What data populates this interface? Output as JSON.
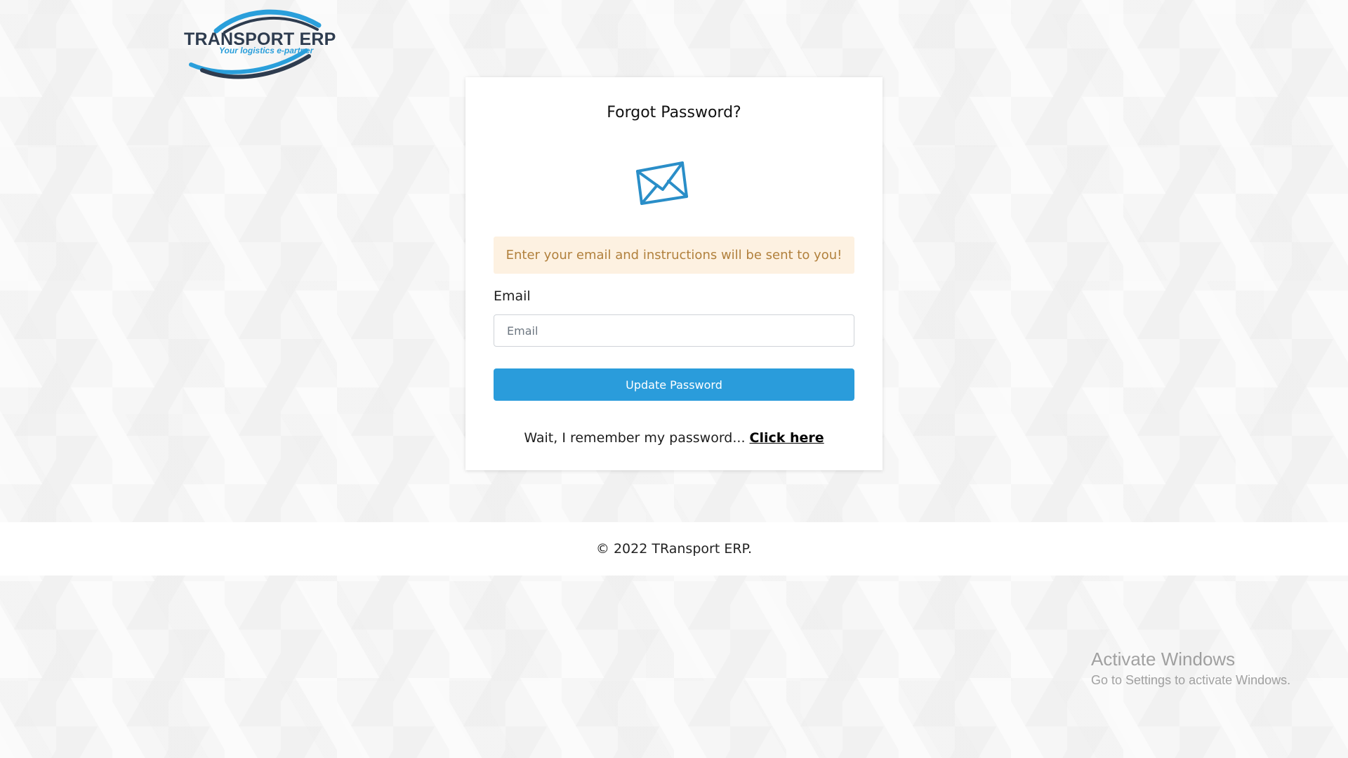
{
  "logo": {
    "title": "TRANSPORT ERP",
    "tagline": "Your logistics e-partner"
  },
  "card": {
    "title": "Forgot Password?",
    "icon": "envelope-icon",
    "alert_text": "Enter your email and instructions will be sent to you!",
    "email_label": "Email",
    "email_placeholder": "Email",
    "email_value": "",
    "submit_label": "Update Password",
    "remember_text": "Wait, I remember my password... ",
    "remember_link": "Click here"
  },
  "footer": {
    "text": "© 2022 TRansport ERP."
  },
  "watermark": {
    "title": "Activate Windows",
    "subtitle": "Go to Settings to activate Windows."
  },
  "colors": {
    "accent": "#2a9cdb",
    "alert_bg": "#fdf1e1",
    "alert_text": "#b1803c",
    "logo_dark": "#2e3c4f"
  }
}
